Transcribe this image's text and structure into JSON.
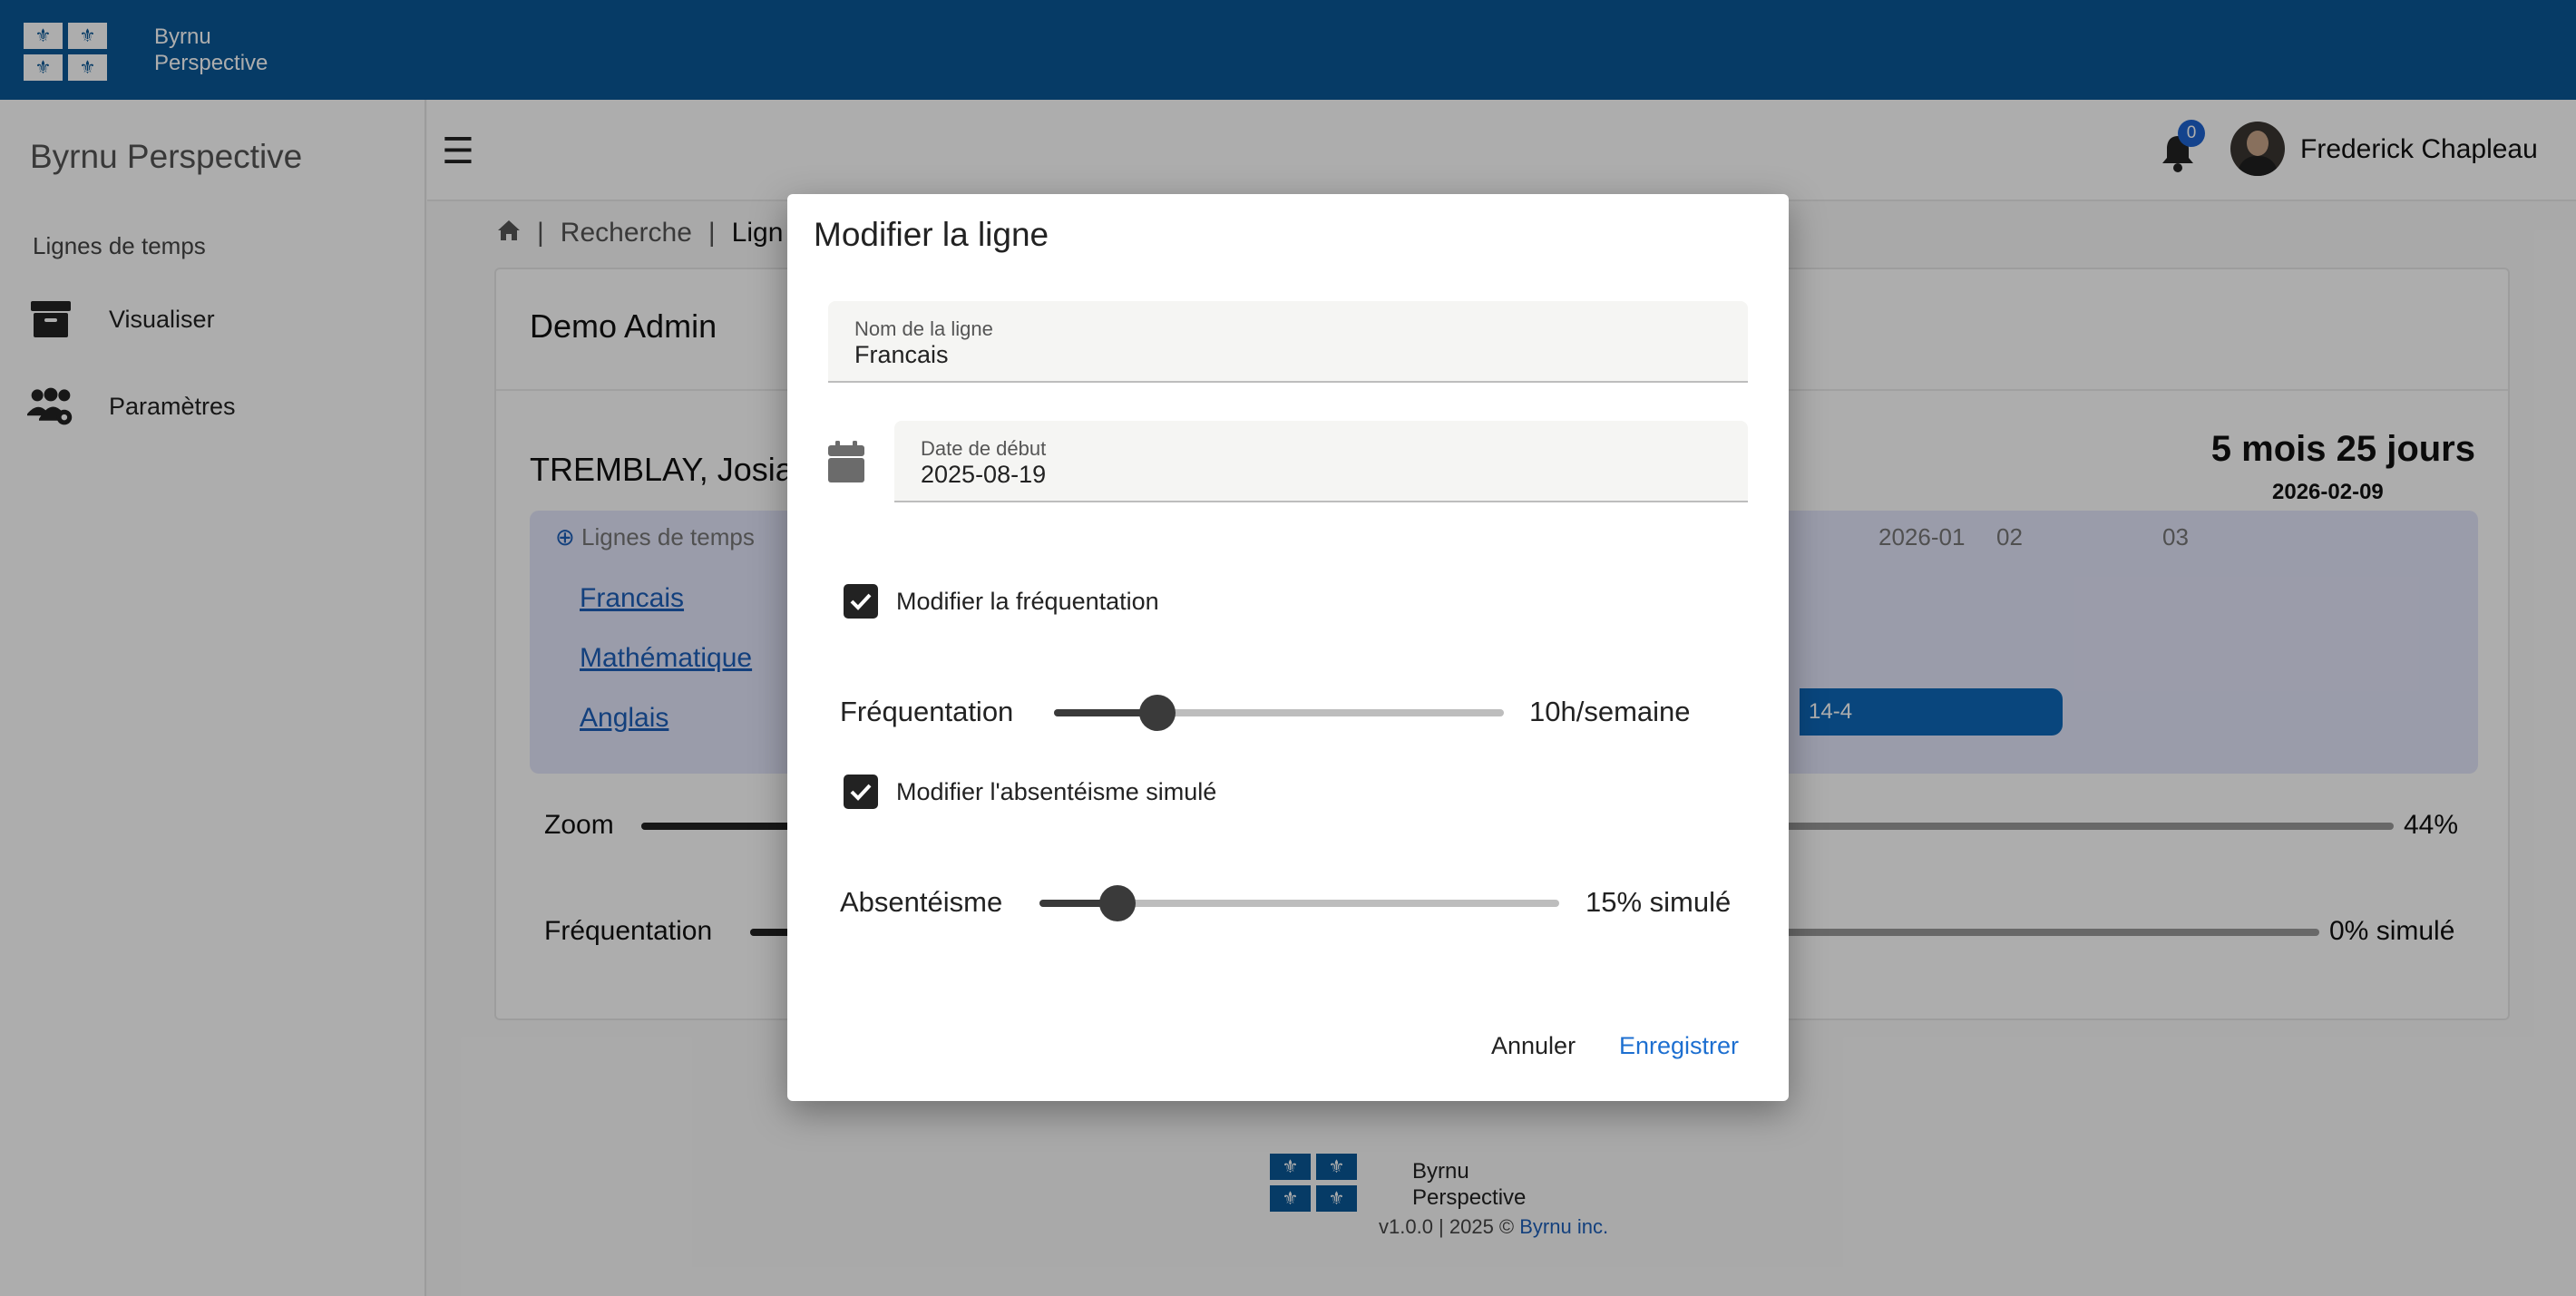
{
  "header": {
    "brand_line1": "Byrnu",
    "brand_line2": "Perspective"
  },
  "sidebar": {
    "title": "Byrnu Perspective",
    "section": "Lignes de temps",
    "items": [
      {
        "label": "Visualiser",
        "icon": "archive-icon"
      },
      {
        "label": "Paramètres",
        "icon": "users-gear-icon"
      }
    ]
  },
  "topbar": {
    "notification_count": "0",
    "user_name": "Frederick Chapleau"
  },
  "breadcrumb": {
    "items": [
      "Recherche",
      "Lign"
    ]
  },
  "card": {
    "title": "Demo Admin",
    "student": "TREMBLAY, Josia",
    "duration": "5 mois 25 jours",
    "end_date": "2026-02-09",
    "timeline": {
      "add_label": "Lignes de temps",
      "lines": [
        "Francais",
        "Mathématique",
        "Anglais"
      ],
      "months": [
        "2026-01",
        "02",
        "03"
      ],
      "bar_label": "14-4"
    },
    "zoom_label": "Zoom",
    "zoom_value": "44%",
    "zoom_fraction": 0.44,
    "freq_label": "Fréquentation",
    "freq_value": "0% simulé"
  },
  "footer": {
    "brand_line1": "Byrnu",
    "brand_line2": "Perspective",
    "version": "v1.0.0 | 2025 © ",
    "company": "Byrnu inc."
  },
  "dialog": {
    "title": "Modifier la ligne",
    "name_label": "Nom de la ligne",
    "name_value": "Francais",
    "date_label": "Date de début",
    "date_value": "2025-08-19",
    "check_freq": "Modifier la fréquentation",
    "freq_label": "Fréquentation",
    "freq_value": "10h/semaine",
    "freq_fraction": 0.23,
    "check_abs": "Modifier l'absentéisme simulé",
    "abs_label": "Absentéisme",
    "abs_value": "15% simulé",
    "abs_fraction": 0.15,
    "cancel": "Annuler",
    "save": "Enregistrer"
  }
}
